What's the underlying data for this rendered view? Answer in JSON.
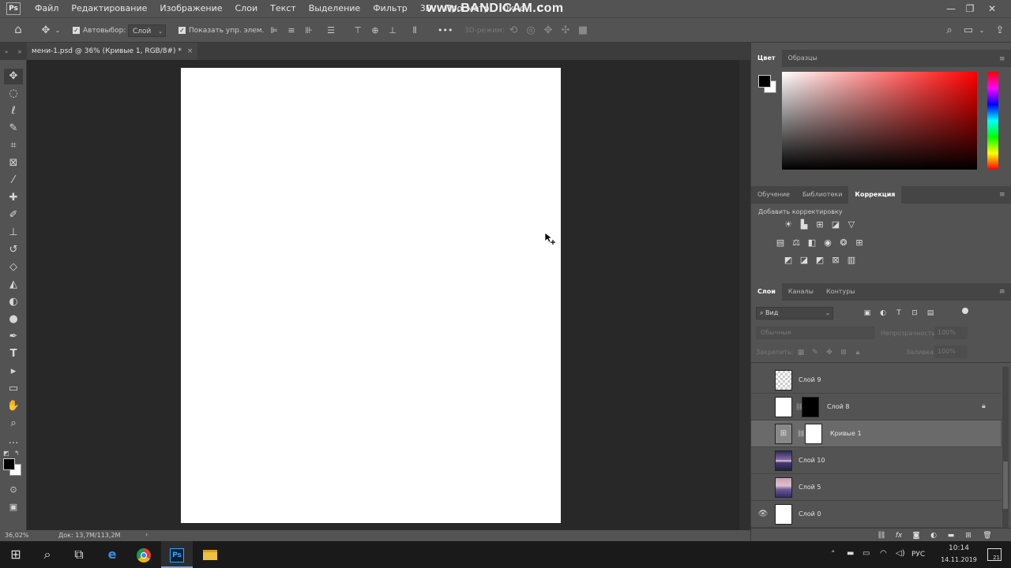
{
  "app": {
    "logo": "Ps",
    "watermark": "www.BANDICAM.com",
    "menu": [
      "Файл",
      "Редактирование",
      "Изображение",
      "Слои",
      "Текст",
      "Выделение",
      "Фильтр",
      "3D",
      "Просмотр",
      "Окно",
      "С"
    ],
    "window_controls": {
      "minimize": "—",
      "restore": "❐",
      "close": "✕"
    }
  },
  "options_bar": {
    "autoselect_label": "Автовыбор:",
    "autoselect_value": "Слой",
    "show_transform_label": "Показать упр. элем.",
    "mode3d_label": "3D-режим:",
    "more": "•••"
  },
  "document": {
    "tab_title": "мени-1.psd @ 36% (Кривые 1, RGB/8#) *",
    "close": "×"
  },
  "status_bar": {
    "zoom": "36,02%",
    "doc_size": "Док: 13,7M/113,2M",
    "arrow": "›"
  },
  "color_panel": {
    "tabs": [
      "Цвет",
      "Образцы"
    ],
    "foreground": "#000000",
    "background": "#ffffff"
  },
  "adjust_panel": {
    "tabs": [
      "Обучение",
      "Библиотеки",
      "Коррекция"
    ],
    "active_tab": "Коррекция",
    "add_label": "Добавить корректировку"
  },
  "layers_panel": {
    "tabs": [
      "Слои",
      "Каналы",
      "Контуры"
    ],
    "filter_label": "Вид",
    "blend_mode": "Обычные",
    "opacity_label": "Непрозрачность:",
    "opacity_value": "100%",
    "lock_label": "Закрепить:",
    "fill_label": "Заливка:",
    "fill_value": "100%",
    "layers": [
      {
        "name": "Слой 9",
        "visible": false,
        "selected": false,
        "locked": false
      },
      {
        "name": "Слой 8",
        "visible": false,
        "selected": false,
        "locked": true
      },
      {
        "name": "Кривые 1",
        "visible": false,
        "selected": true,
        "locked": false
      },
      {
        "name": "Слой 10",
        "visible": false,
        "selected": false,
        "locked": false
      },
      {
        "name": "Слой 5",
        "visible": false,
        "selected": false,
        "locked": false
      },
      {
        "name": "Слой 0",
        "visible": true,
        "selected": false,
        "locked": false
      }
    ],
    "bottom_icons": [
      "link-icon",
      "fx-icon",
      "mask-icon",
      "adjustment-icon",
      "group-icon",
      "new-layer-icon",
      "trash-icon"
    ],
    "fx_label": "fx"
  },
  "taskbar": {
    "lang": "РУС",
    "time": "10:14",
    "date": "14.11.2019",
    "notif_count": "21"
  }
}
